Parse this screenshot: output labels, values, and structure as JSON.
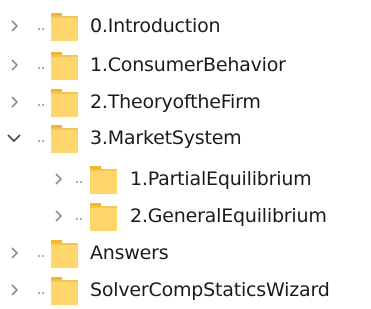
{
  "tree": {
    "items": [
      {
        "label": "0.Introduction",
        "state": "collapsed",
        "level": 0
      },
      {
        "label": "1.ConsumerBehavior",
        "state": "collapsed",
        "level": 0
      },
      {
        "label": "2.TheoryoftheFirm",
        "state": "collapsed",
        "level": 0
      },
      {
        "label": "3.MarketSystem",
        "state": "expanded",
        "level": 0
      },
      {
        "label": "1.PartialEquilibrium",
        "state": "collapsed",
        "level": 1
      },
      {
        "label": "2.GeneralEquilibrium",
        "state": "collapsed",
        "level": 1
      },
      {
        "label": "Answers",
        "state": "collapsed",
        "level": 0
      },
      {
        "label": "SolverCompStaticsWizard",
        "state": "collapsed",
        "level": 0
      }
    ]
  },
  "icons": {
    "collapsed": "chevron-right-icon",
    "expanded": "chevron-down-icon",
    "folder": "folder-icon"
  },
  "colors": {
    "folder_fill": "#FFD66B",
    "folder_tab": "#F2B72E",
    "chevron": "#8a8a8a",
    "text": "#1a1a1a"
  }
}
